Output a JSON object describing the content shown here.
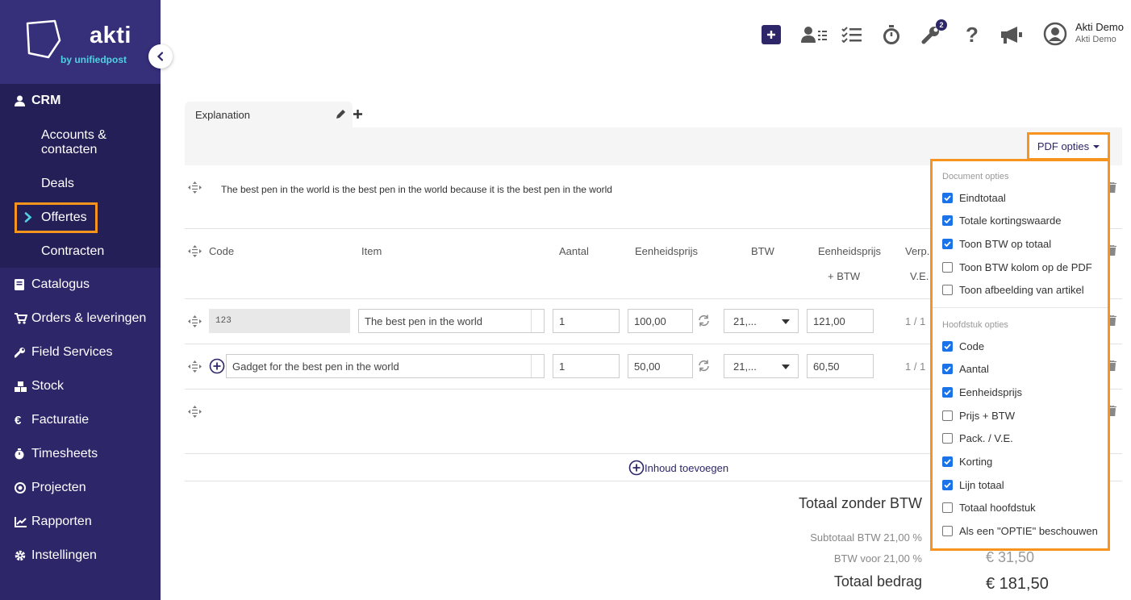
{
  "brand": {
    "name": "akti",
    "tagline": "by unifiedpost"
  },
  "sidebar": {
    "crm": "CRM",
    "crm_items": [
      "Accounts & contacten",
      "Deals",
      "Offertes",
      "Contracten"
    ],
    "items": [
      {
        "label": "Catalogus",
        "icon": "book-icon"
      },
      {
        "label": "Orders & leveringen",
        "icon": "cart-icon"
      },
      {
        "label": "Field Services",
        "icon": "wrench-icon"
      },
      {
        "label": "Stock",
        "icon": "boxes-icon"
      },
      {
        "label": "Facturatie",
        "icon": "euro-icon"
      },
      {
        "label": "Timesheets",
        "icon": "stopwatch-icon"
      },
      {
        "label": "Projecten",
        "icon": "target-icon"
      },
      {
        "label": "Rapporten",
        "icon": "chart-icon"
      },
      {
        "label": "Instellingen",
        "icon": "gear-icon"
      }
    ]
  },
  "header": {
    "badge_count": "2",
    "user_name": "Akti Demo",
    "user_company": "Akti Demo"
  },
  "chapter": {
    "tab_label": "Explanation",
    "pdf_button": "PDF opties",
    "text": "The best pen in the world is the best pen in the world because it is the best pen in the world"
  },
  "table": {
    "headers": {
      "code": "Code",
      "item": "Item",
      "aantal": "Aantal",
      "eenheidsprijs": "Eenheidsprijs",
      "btw": "BTW",
      "eenheidsprijs_btw_1": "Eenheidsprijs",
      "eenheidsprijs_btw_2": "+ BTW",
      "verp_1": "Verp.",
      "verp_2": "V.E."
    },
    "rows": [
      {
        "code": "123",
        "item": "The best pen in the world",
        "aantal": "1",
        "prijs": "100,00",
        "btw": "21,...",
        "prijs_btw": "121,00",
        "ratio": "1 / 1"
      },
      {
        "code": "",
        "item": "Gadget for the best pen in the world",
        "aantal": "1",
        "prijs": "50,00",
        "btw": "21,...",
        "prijs_btw": "60,50",
        "ratio": "1 / 1"
      }
    ],
    "add_content": "Inhoud toevoegen"
  },
  "totals": {
    "excl_label": "Totaal zonder BTW",
    "subtotal_label": "Subtotaal  BTW 21,00 %",
    "btw_label": "BTW voor 21,00 %",
    "btw_value": "€ 31,50",
    "total_label": "Totaal bedrag",
    "total_value": "€ 181,50"
  },
  "pdf_options": {
    "document_header": "Document opties",
    "document": [
      {
        "label": "Eindtotaal",
        "checked": true
      },
      {
        "label": "Totale kortingswaarde",
        "checked": true
      },
      {
        "label": "Toon BTW op totaal",
        "checked": true
      },
      {
        "label": "Toon BTW kolom op de PDF",
        "checked": false
      },
      {
        "label": "Toon afbeelding van artikel",
        "checked": false
      }
    ],
    "chapter_header": "Hoofdstuk opties",
    "chapter": [
      {
        "label": "Code",
        "checked": true
      },
      {
        "label": "Aantal",
        "checked": true
      },
      {
        "label": "Eenheidsprijs",
        "checked": true
      },
      {
        "label": "Prijs + BTW",
        "checked": false
      },
      {
        "label": "Pack. / V.E.",
        "checked": false
      },
      {
        "label": "Korting",
        "checked": true
      },
      {
        "label": "Lijn totaal",
        "checked": true
      },
      {
        "label": "Totaal hoofdstuk",
        "checked": false
      },
      {
        "label": "Als een \"OPTIE\" beschouwen",
        "checked": false
      }
    ]
  },
  "colors": {
    "brand": "#2d2669",
    "highlight": "#f7941d",
    "checkbox": "#1a73e8"
  }
}
